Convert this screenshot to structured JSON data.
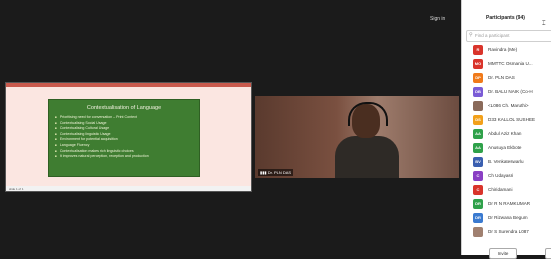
{
  "topbar": {
    "sign_in": "Sign in"
  },
  "share_window": {
    "status_text": "slide 1 of 1",
    "slide": {
      "title": "Contextualisation of Language",
      "bullets": [
        "Prioritising need for conversation – Print Context",
        "Contextualising Social Usage",
        "Contextualising Cultural Usage",
        "Contextualising linguistic Usage",
        "Environment for potential acquisition",
        "Language Fluency",
        "Contextualisation makes rich linguistic choices",
        "It improves natural perception, reception and production"
      ]
    }
  },
  "video": {
    "label": "Dr. PLN DAS"
  },
  "participants": {
    "title": "Participants (94)",
    "find_placeholder": "Find a participant",
    "items": [
      {
        "initials": "R",
        "color": "#d9342b",
        "name": "Ravindra (Me)"
      },
      {
        "initials": "MO",
        "color": "#d9342b",
        "name": "MMTTC Osmania U..."
      },
      {
        "initials": "DP",
        "color": "#f07a1a",
        "name": "Dr. PLN DAS"
      },
      {
        "initials": "DB",
        "color": "#7b5cd6",
        "name": "Dr. BALU NAIK (Co-H"
      },
      {
        "initials": "",
        "color": "#8a6a5a",
        "name": "<L086 Ch. Maruthi>"
      },
      {
        "initials": "DS",
        "color": "#f2a01a",
        "name": "D33 KALLOL SUSHEE"
      },
      {
        "initials": "AA",
        "color": "#2fa14a",
        "name": "Abdul Aziz Khan"
      },
      {
        "initials": "AA",
        "color": "#2fa14a",
        "name": "Anusuya Ekbote"
      },
      {
        "initials": "BV",
        "color": "#3a5fb0",
        "name": "B. Venkateswarlu"
      },
      {
        "initials": "C",
        "color": "#8a3fc4",
        "name": "Ch Udayasri"
      },
      {
        "initials": "C",
        "color": "#d9342b",
        "name": "Chiridamani"
      },
      {
        "initials": "DR",
        "color": "#2fa14a",
        "name": "Dr R N RAMKUMAR"
      },
      {
        "initials": "DR",
        "color": "#3a7ad0",
        "name": "Dr Rizwana Begum"
      },
      {
        "initials": "",
        "color": "#a08070",
        "name": "Dr S Surendra L087"
      }
    ],
    "invite_label": "Invite"
  }
}
